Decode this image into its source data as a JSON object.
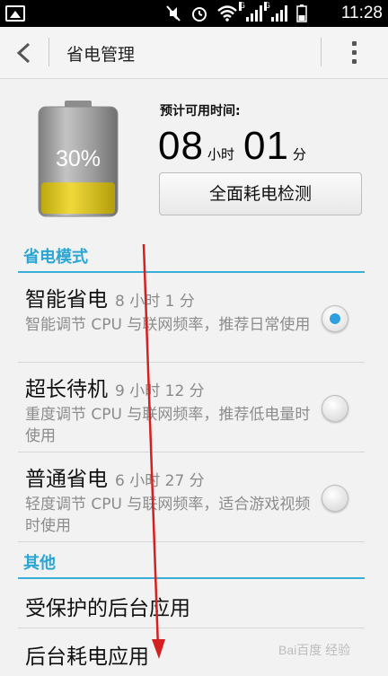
{
  "status_bar": {
    "time": "11:28",
    "left_icon": "image-icon",
    "icons": [
      "mute-icon",
      "alarm-icon",
      "wifi-icon",
      "signal-icon",
      "signal-icon"
    ],
    "network_label": "G"
  },
  "app_bar": {
    "title": "省电管理",
    "back_icon": "back-chevron-icon",
    "more_icon": "overflow-menu-icon"
  },
  "battery": {
    "percent_label": "30%",
    "level": 0.3,
    "colors": {
      "fill": "#d9c21a",
      "body": "#9a9a9a"
    }
  },
  "remaining": {
    "label": "预计可用时间:",
    "hours": "08",
    "hours_unit": "小时",
    "minutes": "01",
    "minutes_unit": "分"
  },
  "check_button": {
    "label": "全面耗电检测"
  },
  "power_modes": {
    "title": "省电模式",
    "items": [
      {
        "name": "智能省电",
        "duration": "8 小时 1 分",
        "description": "智能调节 CPU 与联网频率，推荐日常使用",
        "selected": true
      },
      {
        "name": "超长待机",
        "duration": "9 小时 12 分",
        "description": "重度调节 CPU 与联网频率，推荐低电量时使用",
        "selected": false
      },
      {
        "name": "普通省电",
        "duration": "6 小时 27 分",
        "description": "轻度调节 CPU 与联网频率，适合游戏视频时使用",
        "selected": false
      }
    ]
  },
  "other": {
    "title": "其他",
    "items": [
      {
        "label": "受保护的后台应用"
      },
      {
        "label": "后台耗电应用"
      }
    ]
  },
  "colors": {
    "accent": "#2aa6d3",
    "radio_selected": "#2f9fe0",
    "annotation_arrow": "#d42020"
  },
  "watermark": {
    "text": "Bai百度 经验"
  }
}
